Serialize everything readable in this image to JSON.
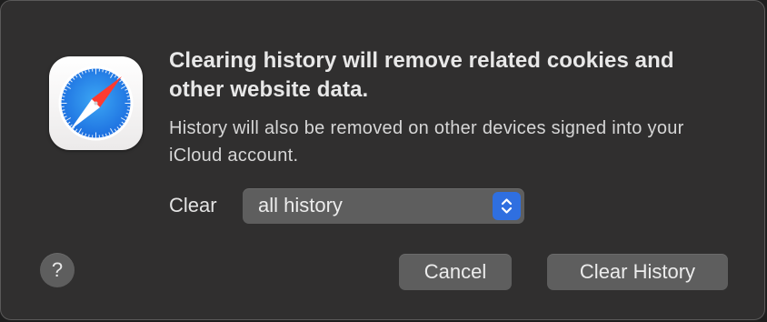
{
  "dialog": {
    "icon": "safari-compass-icon",
    "title": "Clearing history will remove related cookies and other website data.",
    "message": "History will also be removed on other devices signed into your iCloud account.",
    "clear_label": "Clear",
    "range_select": {
      "selected": "all history",
      "icon": "up-down-chevron-icon",
      "accent_color": "#2f6fe0"
    },
    "help_button": "?",
    "cancel_button": "Cancel",
    "confirm_button": "Clear History"
  },
  "colors": {
    "dialog_background": "#302f2f",
    "button_background": "#5e5e5e",
    "text": "#e8e8e8"
  }
}
